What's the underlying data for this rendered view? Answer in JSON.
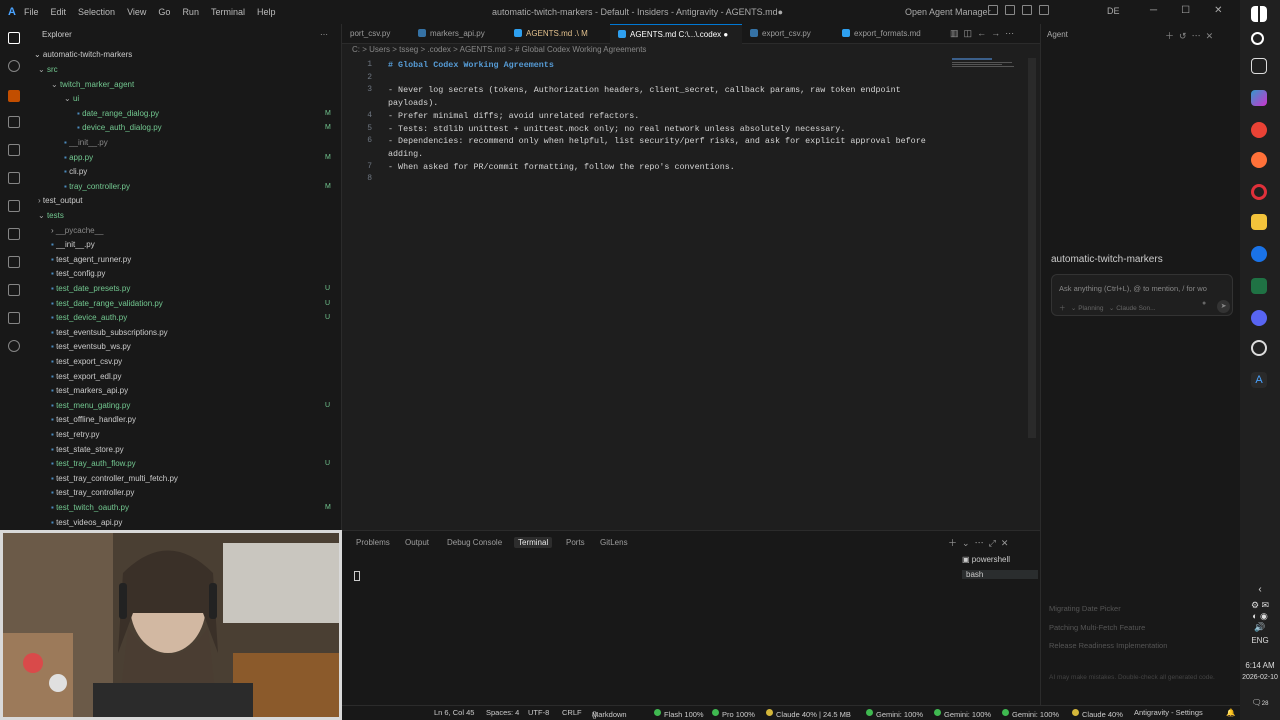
{
  "titlebar": {
    "menu": [
      "File",
      "Edit",
      "Selection",
      "View",
      "Go",
      "Run",
      "Terminal",
      "Help"
    ],
    "window_title": "automatic-twitch-markers - Default - Insiders - Antigravity - AGENTS.md●",
    "open_agent_manager": "Open Agent Manager",
    "language": "DE"
  },
  "sidebar": {
    "header": "Explorer",
    "root": "automatic-twitch-markers",
    "rows": [
      {
        "label": "src",
        "status": ""
      },
      {
        "label": "twitch_marker_agent",
        "status": ""
      },
      {
        "label": "ui",
        "status": ""
      },
      {
        "label": "date_range_dialog.py",
        "status": "M"
      },
      {
        "label": "device_auth_dialog.py",
        "status": "M"
      },
      {
        "label": "__init__.py",
        "status": ""
      },
      {
        "label": "app.py",
        "status": "M"
      },
      {
        "label": "cli.py",
        "status": ""
      },
      {
        "label": "tray_controller.py",
        "status": "M"
      },
      {
        "label": "test_output",
        "status": ""
      },
      {
        "label": "tests",
        "status": ""
      },
      {
        "label": "__pycache__",
        "status": ""
      },
      {
        "label": "__init__.py",
        "status": ""
      },
      {
        "label": "test_agent_runner.py",
        "status": ""
      },
      {
        "label": "test_config.py",
        "status": ""
      },
      {
        "label": "test_date_presets.py",
        "status": "U"
      },
      {
        "label": "test_date_range_validation.py",
        "status": "U"
      },
      {
        "label": "test_device_auth.py",
        "status": "U"
      },
      {
        "label": "test_eventsub_subscriptions.py",
        "status": ""
      },
      {
        "label": "test_eventsub_ws.py",
        "status": ""
      },
      {
        "label": "test_export_csv.py",
        "status": ""
      },
      {
        "label": "test_export_edl.py",
        "status": ""
      },
      {
        "label": "test_markers_api.py",
        "status": ""
      },
      {
        "label": "test_menu_gating.py",
        "status": "U"
      },
      {
        "label": "test_offline_handler.py",
        "status": ""
      },
      {
        "label": "test_retry.py",
        "status": ""
      },
      {
        "label": "test_state_store.py",
        "status": ""
      },
      {
        "label": "test_tray_auth_flow.py",
        "status": "U"
      },
      {
        "label": "test_tray_controller_multi_fetch.py",
        "status": ""
      },
      {
        "label": "test_tray_controller.py",
        "status": ""
      },
      {
        "label": "test_twitch_oauth.py",
        "status": "M"
      },
      {
        "label": "test_videos_api.py",
        "status": ""
      }
    ]
  },
  "tabs": [
    {
      "label": "port_csv.py"
    },
    {
      "label": "markers_api.py"
    },
    {
      "label": "AGENTS.md .\\ M"
    },
    {
      "label": "AGENTS.md C:\\...\\.codex"
    },
    {
      "label": "export_csv.py"
    },
    {
      "label": "export_formats.md"
    }
  ],
  "breadcrumb": "C: > Users > tsseg > .codex > AGENTS.md > # Global Codex Working Agreements",
  "editor": {
    "lines": [
      {
        "n": "1",
        "text": "# Global Codex Working Agreements"
      },
      {
        "n": "2",
        "text": ""
      },
      {
        "n": "3",
        "text": "- Never log secrets (tokens, Authorization headers, client_secret, callback params, raw token endpoint"
      },
      {
        "n": "",
        "text": "payloads)."
      },
      {
        "n": "4",
        "text": "- Prefer minimal diffs; avoid unrelated refactors."
      },
      {
        "n": "5",
        "text": "- Tests: stdlib unittest + unittest.mock only; no real network unless absolutely necessary."
      },
      {
        "n": "6",
        "text": "- Dependencies: recommend only when helpful, list security/perf risks, and ask for explicit approval before"
      },
      {
        "n": "",
        "text": "adding."
      },
      {
        "n": "7",
        "text": "- When asked for PR/commit formatting, follow the repo's conventions."
      },
      {
        "n": "8",
        "text": ""
      }
    ]
  },
  "agent": {
    "header": "Agent",
    "project": "automatic-twitch-markers",
    "placeholder": "Ask anything (Ctrl+L), @ to mention, / for wo",
    "mode": "Planning",
    "model": "Claude Son...",
    "recent": [
      "Migrating Date Picker",
      "Patching Multi-Fetch Feature",
      "Release Readiness Implementation"
    ],
    "footer": "AI may make mistakes. Double-check all generated code."
  },
  "panel": {
    "tabs": [
      "Problems",
      "Output",
      "Debug Console",
      "Terminal",
      "Ports",
      "GitLens"
    ],
    "active_tab": "Terminal",
    "shells": [
      "powershell",
      "bash"
    ]
  },
  "status": {
    "position": "Ln 6, Col 45",
    "spaces": "Spaces: 4",
    "encoding": "UTF-8",
    "eol": "CRLF",
    "language": "Markdown",
    "quotas": [
      {
        "label": "Flash 100%",
        "color": "#3fb950"
      },
      {
        "label": "Pro 100%",
        "color": "#3fb950"
      },
      {
        "label": "Claude 40% | 24.5 MB",
        "color": "#d4b73a"
      },
      {
        "label": "Gemini: 100%",
        "color": "#3fb950"
      },
      {
        "label": "Gemini: 100%",
        "color": "#3fb950"
      },
      {
        "label": "Gemini: 100%",
        "color": "#3fb950"
      },
      {
        "label": "Claude 40%",
        "color": "#d4b73a"
      }
    ],
    "settings": "Antigravity - Settings"
  },
  "taskbar": {
    "lang": "ENG",
    "time": "6:14 AM",
    "date": "2026-02-10",
    "notif": "28"
  },
  "colors": {
    "accent": "#0078d4",
    "modified": "#e2c08d",
    "untracked": "#73c991"
  }
}
